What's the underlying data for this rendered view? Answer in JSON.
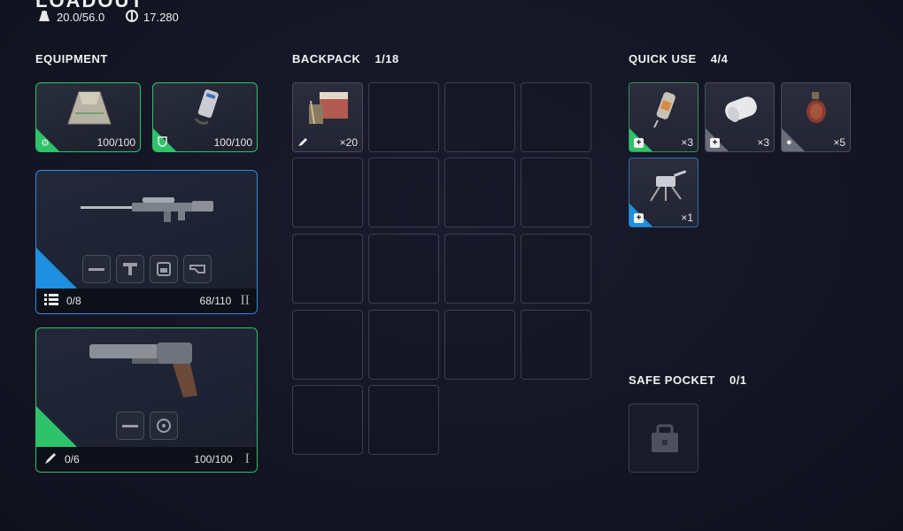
{
  "header": {
    "title": "LOADOUT",
    "weight": "20.0/56.0",
    "currency": "17.280"
  },
  "equipment": {
    "label": "EQUIPMENT",
    "augment": {
      "durability": "100/100",
      "icon": "augment-icon"
    },
    "shield": {
      "durability": "100/100",
      "icon": "shield-icon"
    },
    "weapon1": {
      "ammo": "0/8",
      "durability": "68/110",
      "tier": "II",
      "name": "sniper-rifle"
    },
    "weapon2": {
      "ammo": "0/6",
      "durability": "100/100",
      "tier": "I",
      "name": "revolver"
    }
  },
  "backpack": {
    "label": "BACKPACK",
    "count": "1/18",
    "item": {
      "name": "ammo-crate",
      "qty": "×20"
    }
  },
  "quick_use": {
    "label": "QUICK USE",
    "count": "4/4",
    "items": [
      {
        "name": "injector",
        "qty": "×3",
        "rarity": "#2ec26a"
      },
      {
        "name": "bandage",
        "qty": "×3",
        "rarity": "#6a6d7a"
      },
      {
        "name": "grenade",
        "qty": "×5",
        "rarity": "#6a6d7a"
      },
      {
        "name": "turret",
        "qty": "×1",
        "rarity": "#1f8fe0"
      }
    ]
  },
  "safe_pocket": {
    "label": "SAFE POCKET",
    "count": "0/1"
  }
}
